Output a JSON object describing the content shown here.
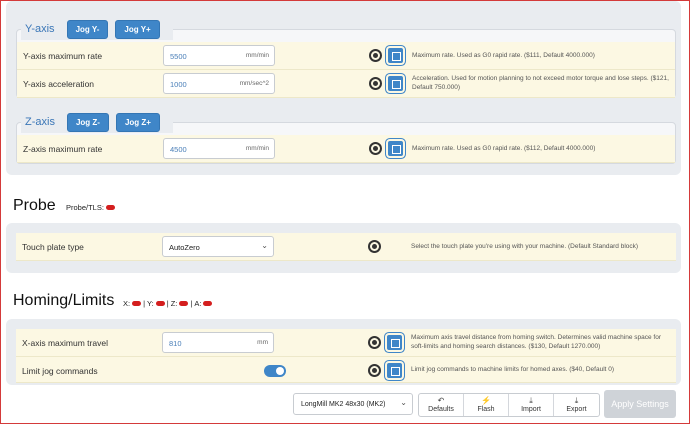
{
  "y_axis": {
    "title": "Y-axis",
    "jog_minus": "Jog Y-",
    "jog_plus": "Jog Y+",
    "rows": [
      {
        "label": "Y-axis maximum rate",
        "value": "5500",
        "unit": "mm/min",
        "desc": "Maximum rate. Used as G0 rapid rate. ($111, Default 4000.000)"
      },
      {
        "label": "Y-axis acceleration",
        "value": "1000",
        "unit": "mm/sec^2",
        "desc": "Acceleration. Used for motion planning to not exceed motor torque and lose steps. ($121, Default 750.000)"
      }
    ]
  },
  "z_axis": {
    "title": "Z-axis",
    "jog_minus": "Jog Z-",
    "jog_plus": "Jog Z+",
    "rows": [
      {
        "label": "Z-axis maximum rate",
        "value": "4500",
        "unit": "mm/min",
        "desc": "Maximum rate. Used as G0 rapid rate. ($112, Default 4000.000)"
      }
    ]
  },
  "probe": {
    "title": "Probe",
    "status_label": "Probe/TLS:",
    "touch_plate": {
      "label": "Touch plate type",
      "value": "AutoZero",
      "desc": "Select the touch plate you're using with your machine. (Default Standard block)"
    }
  },
  "homing": {
    "title": "Homing/Limits",
    "status": {
      "x": "X:",
      "y": "Y:",
      "z": "Z:",
      "a": "A:",
      "sep": "|"
    },
    "rows": [
      {
        "label": "X-axis maximum travel",
        "value": "810",
        "unit": "mm",
        "desc": "Maximum axis travel distance from homing switch. Determines valid machine space for soft-limits and homing search distances. ($130, Default 1270.000)"
      },
      {
        "label": "Limit jog commands",
        "desc": "Limit jog commands to machine limits for homed axes. ($40, Default 0)",
        "toggle_on": true
      }
    ]
  },
  "footer": {
    "machine": "LongMill MK2 48x30 (MK2)",
    "buttons": [
      {
        "label": "Defaults",
        "icon": "↶"
      },
      {
        "label": "Flash",
        "icon": "⚡"
      },
      {
        "label": "Import",
        "icon": "⤓"
      },
      {
        "label": "Export",
        "icon": "⤓"
      }
    ],
    "apply": "Apply Settings"
  },
  "colors": {
    "accent": "#3f86c8",
    "row_bg": "#fcf8e3",
    "status_off": "#d41e1e"
  }
}
